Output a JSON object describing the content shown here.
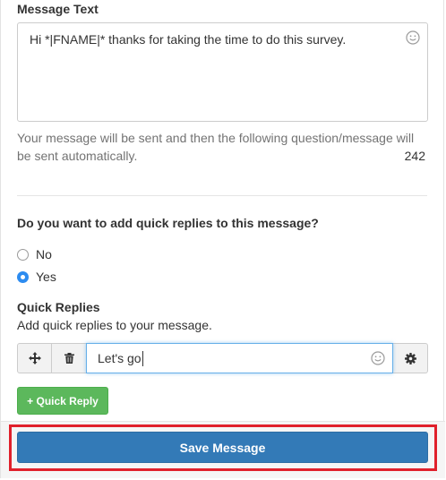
{
  "message": {
    "label": "Message Text",
    "text": "Hi *|FNAME|* thanks for taking the time to do this survey.",
    "help": "Your message will be sent and then the following question/message will be sent automatically.",
    "char_count": "242"
  },
  "quick_replies_question": {
    "label": "Do you want to add quick replies to this message?",
    "options": [
      {
        "label": "No",
        "selected": false
      },
      {
        "label": "Yes",
        "selected": true
      }
    ]
  },
  "quick_replies": {
    "title": "Quick Replies",
    "subtitle": "Add quick replies to your message.",
    "items": [
      {
        "value": "Let's go"
      }
    ],
    "add_label": "+ Quick Reply"
  },
  "footer": {
    "save_label": "Save Message"
  },
  "colors": {
    "primary": "#337ab7",
    "success": "#5cb85c",
    "radio_selected": "#2d8cf0",
    "highlight": "#e0202b"
  }
}
